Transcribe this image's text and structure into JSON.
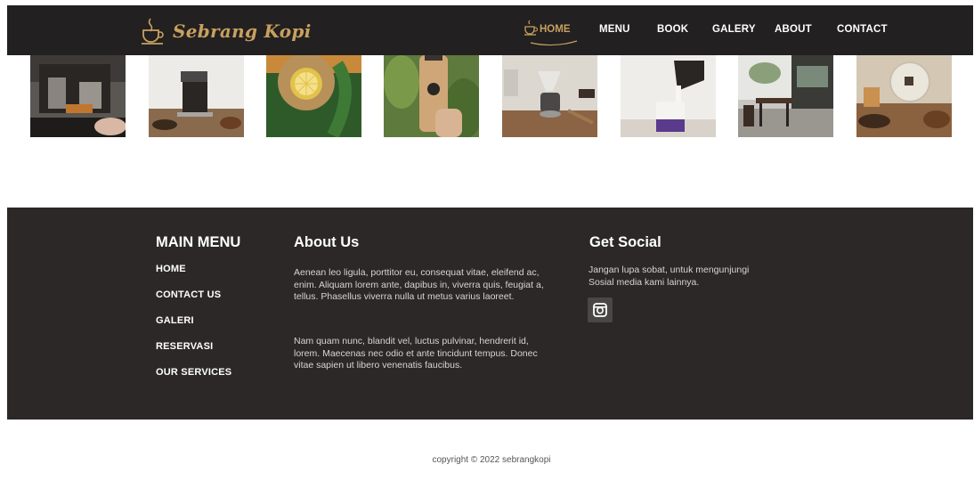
{
  "brand": {
    "name": "Sebrang Kopi",
    "icon": "coffee-cup-icon"
  },
  "nav": {
    "items": [
      {
        "label": "HOME",
        "active": true
      },
      {
        "label": "MENU"
      },
      {
        "label": "BOOK"
      },
      {
        "label": "GALERY"
      },
      {
        "label": "ABOUT"
      },
      {
        "label": "CONTACT"
      }
    ]
  },
  "gallery": {
    "photos": [
      "espresso-machine",
      "drip-coffee-cup",
      "lemon-drink",
      "bottled-coffee",
      "pour-over",
      "milk-pour",
      "cafe-interior",
      "coffee-pot"
    ]
  },
  "footer": {
    "main_menu": {
      "title": "MAIN MENU",
      "links": [
        "HOME",
        "CONTACT US",
        "GALERI",
        "RESERVASI",
        "OUR SERVICES"
      ]
    },
    "about": {
      "title": "About Us",
      "paragraph1": "Aenean leo ligula, porttitor eu, consequat vitae, eleifend ac, enim. Aliquam lorem ante, dapibus in, viverra quis, feugiat a, tellus. Phasellus viverra nulla ut metus varius laoreet.",
      "paragraph2": "Nam quam nunc, blandit vel, luctus pulvinar, hendrerit id, lorem. Maecenas nec odio et ante tincidunt tempus. Donec vitae sapien ut libero venenatis faucibus."
    },
    "social": {
      "title": "Get Social",
      "text": "Jangan lupa sobat, untuk mengunjungi Sosial media kami lainnya.",
      "icon": "instagram-icon"
    }
  },
  "copyright": "copyright © 2022 sebrangkopi",
  "colors": {
    "navbar": "#222020",
    "footer": "#2c2828",
    "accent": "#c8a060"
  }
}
